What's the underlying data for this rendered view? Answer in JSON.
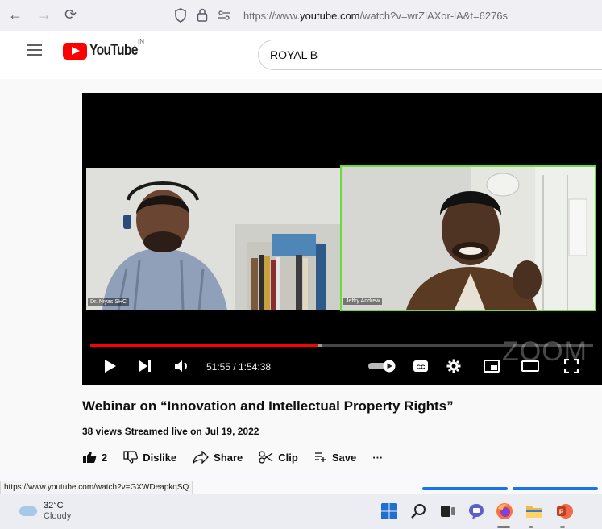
{
  "browser": {
    "url_prefix": "https://www.",
    "url_domain": "youtube.com",
    "url_path": "/watch?v=wrZlAXor-lA&t=6276s"
  },
  "youtube": {
    "logo_text": "YouTube",
    "country_code": "IN",
    "search_value": "ROYAL B"
  },
  "player": {
    "participants": [
      "Dr. Niyas SHC",
      "Jeffry Andrew"
    ],
    "time": "51:55 / 1:54:38",
    "progress": 0.453,
    "watermark": "ZOOM"
  },
  "video": {
    "title": "Webinar on “Innovation and Intellectual Property Rights”",
    "meta": "38 views  Streamed live on Jul 19, 2022"
  },
  "actions": {
    "like_count": "2",
    "dislike": "Dislike",
    "share": "Share",
    "clip": "Clip",
    "save": "Save",
    "more": "···"
  },
  "status_link": "https://www.youtube.com/watch?v=GXWDeapkqSQ",
  "taskbar": {
    "temp": "32°C",
    "condition": "Cloudy"
  },
  "colors": {
    "brand_red": "#ff0000",
    "speaker_border": "#6bdb3a",
    "accent_blue": "#1a73e8"
  }
}
